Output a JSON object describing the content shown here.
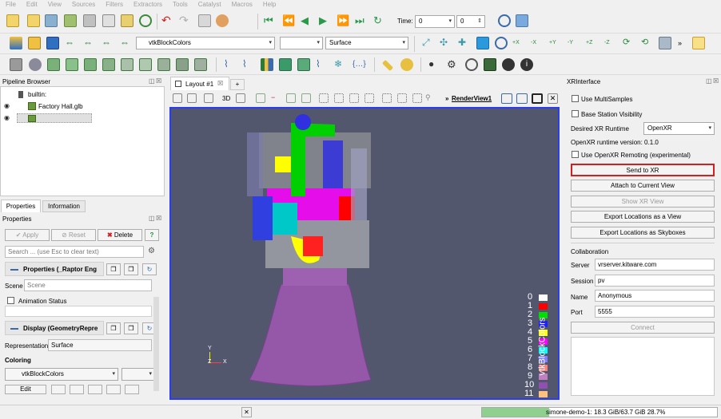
{
  "menu": [
    "File",
    "Edit",
    "View",
    "Sources",
    "Filters",
    "Extractors",
    "Tools",
    "Catalyst",
    "Macros",
    "Help"
  ],
  "toolbar": {
    "time_label": "Time:",
    "time_value": "0",
    "time_step": "0",
    "color_by": "vtkBlockColors",
    "representation": "Surface"
  },
  "pipeline": {
    "title": "Pipeline Browser",
    "items": [
      "builtin:",
      "Factory Hall.glb"
    ]
  },
  "properties": {
    "tabs": [
      "Properties",
      "Information"
    ],
    "title": "Properties",
    "apply": "Apply",
    "reset": "Reset",
    "delete": "Delete",
    "help": "?",
    "search_placeholder": "Search ... (use Esc to clear text)",
    "section1": "Properties (_Raptor Eng",
    "scene_label": "Scene",
    "scene_value": "Scene",
    "animation_status": "Animation Status",
    "section2": "Display (GeometryRepre",
    "representation_label": "Representation",
    "representation_value": "Surface",
    "coloring_label": "Coloring",
    "coloring_value": "vtkBlockColors",
    "edit": "Edit"
  },
  "layout": {
    "tab": "Layout #1",
    "add_tab": "+",
    "view_3d": "3D",
    "view_name": "RenderView1"
  },
  "legend": {
    "title": "vtkBlockColors",
    "entries": [
      {
        "label": "0",
        "color": "#ffffff"
      },
      {
        "label": "1",
        "color": "#ff0000"
      },
      {
        "label": "2",
        "color": "#00e000"
      },
      {
        "label": "3",
        "color": "#2020ff"
      },
      {
        "label": "4",
        "color": "#ffff00"
      },
      {
        "label": "5",
        "color": "#ff00ff"
      },
      {
        "label": "6",
        "color": "#00ffff"
      },
      {
        "label": "7",
        "color": "#7f7fff"
      },
      {
        "label": "8",
        "color": "#ff7f7f"
      },
      {
        "label": "9",
        "color": "#c080c0"
      },
      {
        "label": "10",
        "color": "#9050b0"
      },
      {
        "label": "11",
        "color": "#ffc080"
      }
    ]
  },
  "axes": {
    "y": "Y",
    "z": "Z",
    "x": "X"
  },
  "xr": {
    "title": "XRInterface",
    "use_multisamples": "Use MultiSamples",
    "base_station": "Base Station Visibility",
    "desired_runtime_label": "Desired XR Runtime",
    "desired_runtime_value": "OpenXR",
    "runtime_version": "OpenXR runtime version: 0.1.0",
    "use_remoting": "Use OpenXR Remoting (experimental)",
    "send_to_xr": "Send to XR",
    "attach": "Attach to Current View",
    "show_xr_view": "Show XR View",
    "export_view": "Export Locations as a View",
    "export_skyboxes": "Export Locations as Skyboxes",
    "collaboration": "Collaboration",
    "server_label": "Server",
    "server_value": "vrserver.kitware.com",
    "session_label": "Session",
    "session_value": "pv",
    "name_label": "Name",
    "name_value": "Anonymous",
    "port_label": "Port",
    "port_value": "5555",
    "connect": "Connect"
  },
  "status": {
    "memory": "simone-demo-1: 18.3 GiB/63.7 GiB 28.7%",
    "memory_fraction": 0.287
  }
}
